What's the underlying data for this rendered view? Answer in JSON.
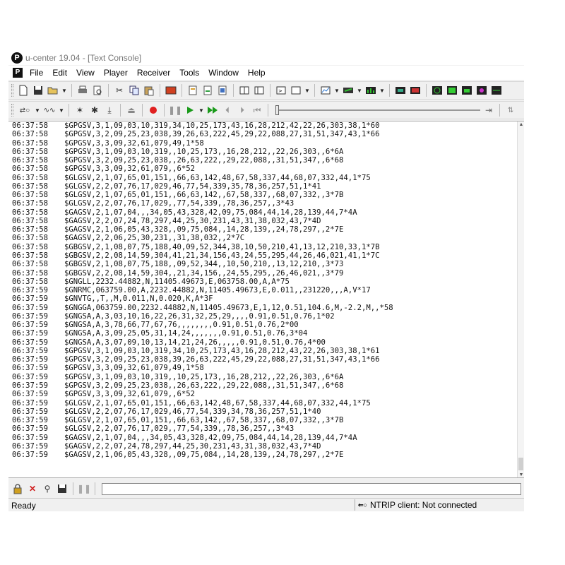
{
  "window": {
    "title": "u-center 19.04 - [Text Console]",
    "logo_letter": "P"
  },
  "menu": [
    "File",
    "Edit",
    "View",
    "Player",
    "Receiver",
    "Tools",
    "Window",
    "Help"
  ],
  "console": {
    "lines": [
      [
        "06:37:58",
        "$GPGSV,3,1,09,03,10,319,34,10,25,173,43,16,28,212,42,22,26,303,38,1*60"
      ],
      [
        "06:37:58",
        "$GPGSV,3,2,09,25,23,038,39,26,63,222,45,29,22,088,27,31,51,347,43,1*66"
      ],
      [
        "06:37:58",
        "$GPGSV,3,3,09,32,61,079,49,1*58"
      ],
      [
        "06:37:58",
        "$GPGSV,3,1,09,03,10,319,,10,25,173,,16,28,212,,22,26,303,,6*6A"
      ],
      [
        "06:37:58",
        "$GPGSV,3,2,09,25,23,038,,26,63,222,,29,22,088,,31,51,347,,6*68"
      ],
      [
        "06:37:58",
        "$GPGSV,3,3,09,32,61,079,,6*52"
      ],
      [
        "06:37:58",
        "$GLGSV,2,1,07,65,01,151,,66,63,142,48,67,58,337,44,68,07,332,44,1*75"
      ],
      [
        "06:37:58",
        "$GLGSV,2,2,07,76,17,029,46,77,54,339,35,78,36,257,51,1*41"
      ],
      [
        "06:37:58",
        "$GLGSV,2,1,07,65,01,151,,66,63,142,,67,58,337,,68,07,332,,3*7B"
      ],
      [
        "06:37:58",
        "$GLGSV,2,2,07,76,17,029,,77,54,339,,78,36,257,,3*43"
      ],
      [
        "06:37:58",
        "$GAGSV,2,1,07,04,,,34,05,43,328,42,09,75,084,44,14,28,139,44,7*4A"
      ],
      [
        "06:37:58",
        "$GAGSV,2,2,07,24,78,297,44,25,30,231,43,31,38,032,43,7*4D"
      ],
      [
        "06:37:58",
        "$GAGSV,2,1,06,05,43,328,,09,75,084,,14,28,139,,24,78,297,,2*7E"
      ],
      [
        "06:37:58",
        "$GAGSV,2,2,06,25,30,231,,31,38,032,,2*7C"
      ],
      [
        "06:37:58",
        "$GBGSV,2,1,08,07,75,188,40,09,52,344,38,10,50,210,41,13,12,210,33,1*7B"
      ],
      [
        "06:37:58",
        "$GBGSV,2,2,08,14,59,304,41,21,34,156,43,24,55,295,44,26,46,021,41,1*7C"
      ],
      [
        "06:37:58",
        "$GBGSV,2,1,08,07,75,188,,09,52,344,,10,50,210,,13,12,210,,3*73"
      ],
      [
        "06:37:58",
        "$GBGSV,2,2,08,14,59,304,,21,34,156,,24,55,295,,26,46,021,,3*79"
      ],
      [
        "06:37:58",
        "$GNGLL,2232.44882,N,11405.49673,E,063758.00,A,A*75"
      ],
      [
        "06:37:59",
        "$GNRMC,063759.00,A,2232.44882,N,11405.49673,E,0.011,,231220,,,A,V*17"
      ],
      [
        "06:37:59",
        "$GNVTG,,T,,M,0.011,N,0.020,K,A*3F"
      ],
      [
        "06:37:59",
        "$GNGGA,063759.00,2232.44882,N,11405.49673,E,1,12,0.51,104.6,M,-2.2,M,,*58"
      ],
      [
        "06:37:59",
        "$GNGSA,A,3,03,10,16,22,26,31,32,25,29,,,,0.91,0.51,0.76,1*02"
      ],
      [
        "06:37:59",
        "$GNGSA,A,3,78,66,77,67,76,,,,,,,,0.91,0.51,0.76,2*00"
      ],
      [
        "06:37:59",
        "$GNGSA,A,3,09,25,05,31,14,24,,,,,,,0.91,0.51,0.76,3*04"
      ],
      [
        "06:37:59",
        "$GNGSA,A,3,07,09,10,13,14,21,24,26,,,,,0.91,0.51,0.76,4*00"
      ],
      [
        "06:37:59",
        "$GPGSV,3,1,09,03,10,319,34,10,25,173,43,16,28,212,43,22,26,303,38,1*61"
      ],
      [
        "06:37:59",
        "$GPGSV,3,2,09,25,23,038,39,26,63,222,45,29,22,088,27,31,51,347,43,1*66"
      ],
      [
        "06:37:59",
        "$GPGSV,3,3,09,32,61,079,49,1*58"
      ],
      [
        "06:37:59",
        "$GPGSV,3,1,09,03,10,319,,10,25,173,,16,28,212,,22,26,303,,6*6A"
      ],
      [
        "06:37:59",
        "$GPGSV,3,2,09,25,23,038,,26,63,222,,29,22,088,,31,51,347,,6*68"
      ],
      [
        "06:37:59",
        "$GPGSV,3,3,09,32,61,079,,6*52"
      ],
      [
        "06:37:59",
        "$GLGSV,2,1,07,65,01,151,,66,63,142,48,67,58,337,44,68,07,332,44,1*75"
      ],
      [
        "06:37:59",
        "$GLGSV,2,2,07,76,17,029,46,77,54,339,34,78,36,257,51,1*40"
      ],
      [
        "06:37:59",
        "$GLGSV,2,1,07,65,01,151,,66,63,142,,67,58,337,,68,07,332,,3*7B"
      ],
      [
        "06:37:59",
        "$GLGSV,2,2,07,76,17,029,,77,54,339,,78,36,257,,3*43"
      ],
      [
        "06:37:59",
        "$GAGSV,2,1,07,04,,,34,05,43,328,42,09,75,084,44,14,28,139,44,7*4A"
      ],
      [
        "06:37:59",
        "$GAGSV,2,2,07,24,78,297,44,25,30,231,43,31,38,032,43,7*4D"
      ],
      [
        "06:37:59",
        "$GAGSV,2,1,06,05,43,328,,09,75,084,,14,28,139,,24,78,297,,2*7E"
      ]
    ]
  },
  "status": {
    "left": "Ready",
    "ntrip_icon": "NTRIP-icon",
    "ntrip": "NTRIP client: Not connected"
  },
  "command_input": {
    "value": ""
  },
  "colors": {
    "record": "#e02020",
    "play": "#1a9a1a",
    "accent": "#1060c0"
  },
  "toolbar1_icons": [
    "new-icon",
    "open-icon",
    "save-icon",
    "folder-icon",
    "print-icon",
    "print-preview-icon",
    "cut-icon",
    "copy-icon",
    "paste-icon",
    "tools-icon",
    "config-icon",
    "config2-icon",
    "config3-icon",
    "window1-icon",
    "window2-icon",
    "console-icon",
    "view-icon",
    "chart-icon",
    "gauge-icon",
    "bar-icon",
    "map-icon",
    "table-icon",
    "sat-icon",
    "sky-icon",
    "stat-icon",
    "deviation-icon"
  ],
  "toolbar2_icons": [
    "connection-icon",
    "baudrate-icon",
    "autobaud-icon",
    "poll-icon",
    "eject-icon",
    "record-icon",
    "pause-icon",
    "play-icon",
    "fast-forward-icon",
    "step-back-icon",
    "step-forward-icon",
    "rewind-icon",
    "end-icon"
  ]
}
